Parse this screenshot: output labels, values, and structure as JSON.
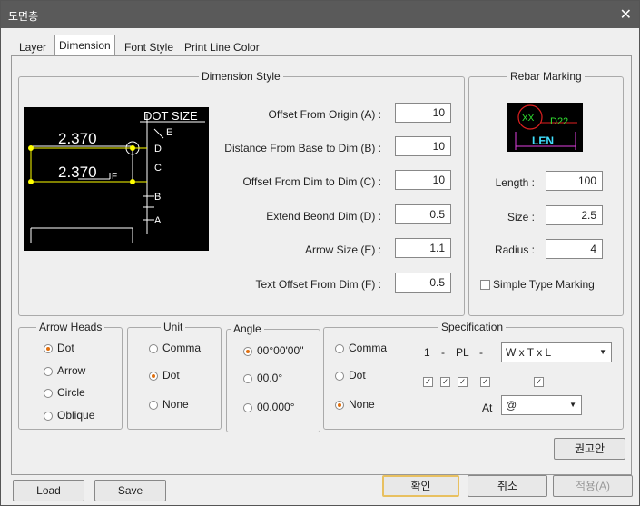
{
  "window": {
    "title": "도면층"
  },
  "tabs": [
    "Layer",
    "Dimension",
    "Font Style",
    "Print Line Color"
  ],
  "dimension_style": {
    "title": "Dimension Style",
    "preview": {
      "dot_size": "DOT SIZE",
      "val1": "2.370",
      "val2": "2.370",
      "labels": [
        "E",
        "D",
        "C",
        "B",
        "A",
        "F"
      ]
    },
    "fields": [
      {
        "label": "Offset From Origin (A) :",
        "value": "10"
      },
      {
        "label": "Distance From Base to Dim (B) :",
        "value": "10"
      },
      {
        "label": "Offset From Dim to Dim (C) :",
        "value": "10"
      },
      {
        "label": "Extend Beond Dim (D) :",
        "value": "0.5"
      },
      {
        "label": "Arrow Size (E) :",
        "value": "1.1"
      },
      {
        "label": "Text Offset From Dim (F) :",
        "value": "0.5"
      }
    ]
  },
  "rebar_marking": {
    "title": "Rebar Marking",
    "preview": {
      "xx": "XX",
      "d22": "D22",
      "len": "LEN"
    },
    "fields": [
      {
        "label": "Length :",
        "value": "100"
      },
      {
        "label": "Size :",
        "value": "2.5"
      },
      {
        "label": "Radius :",
        "value": "4"
      }
    ],
    "simple_type": "Simple Type Marking"
  },
  "arrow_heads": {
    "title": "Arrow Heads",
    "options": [
      "Dot",
      "Arrow",
      "Circle",
      "Oblique"
    ],
    "selected": 0
  },
  "unit": {
    "title": "Unit",
    "options": [
      "Comma",
      "Dot",
      "None"
    ],
    "selected": 1
  },
  "angle": {
    "title": "Angle",
    "options": [
      "00°00'00''",
      "00.0°",
      "00.000°"
    ],
    "selected": 0
  },
  "specification": {
    "title": "Specification",
    "options": [
      "Comma",
      "Dot",
      "None"
    ],
    "selected": 2,
    "prefix": [
      "1",
      "-",
      "PL",
      "-"
    ],
    "format_value": "W x T x L",
    "at_label": "At",
    "at_value": "@"
  },
  "buttons": {
    "recommend": "권고안",
    "load": "Load",
    "save": "Save",
    "ok": "확인",
    "cancel": "취소",
    "apply": "적용(A)"
  }
}
